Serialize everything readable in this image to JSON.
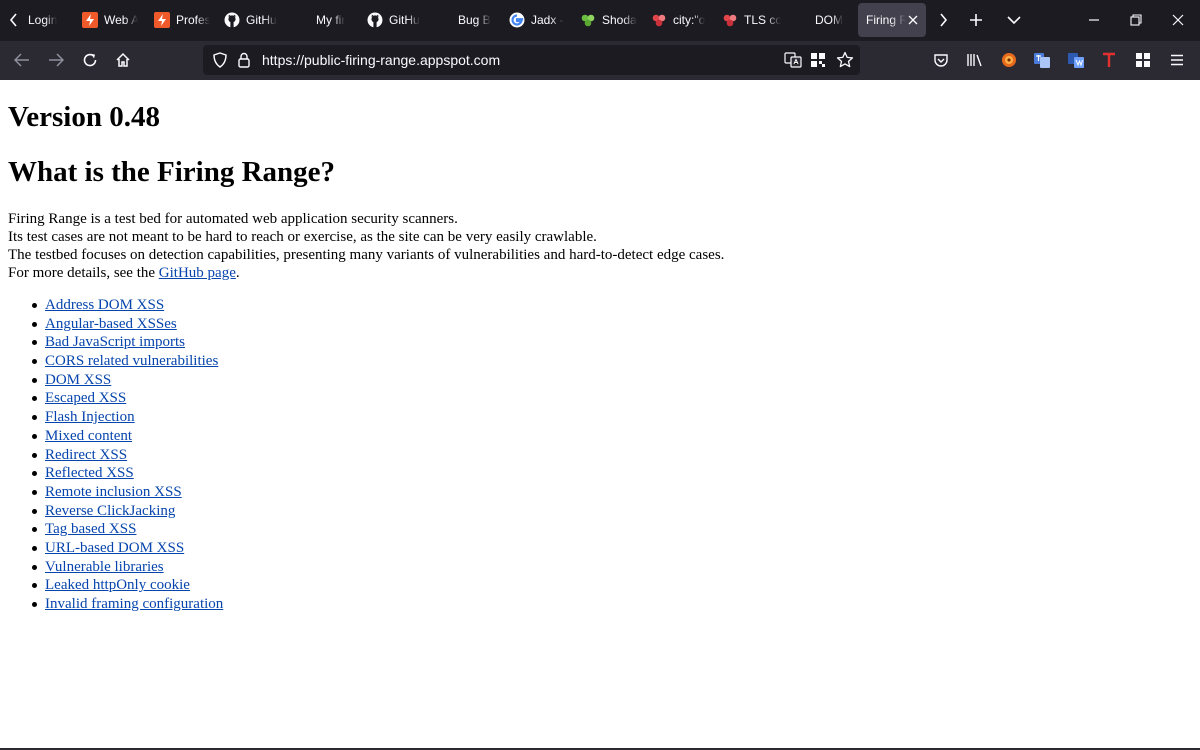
{
  "browser": {
    "tabs": [
      {
        "label": "Login",
        "icon": "login-icon"
      },
      {
        "label": "Web A",
        "icon": "bolt-icon"
      },
      {
        "label": "Profes",
        "icon": "bolt-icon"
      },
      {
        "label": "GitHu",
        "icon": "github-icon"
      },
      {
        "label": "My fir",
        "icon": ""
      },
      {
        "label": "GitHu",
        "icon": "github-icon"
      },
      {
        "label": "Bug B",
        "icon": ""
      },
      {
        "label": "Jadx -",
        "icon": "google-icon"
      },
      {
        "label": "Shoda",
        "icon": "shodan-icon"
      },
      {
        "label": "city:\"o",
        "icon": "shodan-red-icon"
      },
      {
        "label": "TLS cc",
        "icon": "shodan-red-icon"
      },
      {
        "label": "DOM",
        "icon": ""
      },
      {
        "label": "Firing R",
        "icon": "",
        "active": true
      }
    ],
    "url": "https://public-firing-range.appspot.com",
    "colors": {
      "tabbar": "#1c1b22",
      "navbar": "#2b2a33",
      "urlbar": "#1c1b22",
      "link": "#0645ad"
    }
  },
  "page": {
    "version_heading": "Version 0.48",
    "main_heading": "What is the Firing Range?",
    "intro_lines": [
      "Firing Range is a test bed for automated web application security scanners.",
      "Its test cases are not meant to be hard to reach or exercise, as the site can be very easily crawlable.",
      "The testbed focuses on detection capabilities, presenting many variants of vulnerabilities and hard-to-detect edge cases."
    ],
    "details_prefix": "For more details, see the ",
    "details_link": "GitHub page",
    "details_suffix": ".",
    "links": [
      "Address DOM XSS",
      "Angular-based XSSes",
      "Bad JavaScript imports",
      "CORS related vulnerabilities",
      "DOM XSS",
      "Escaped XSS",
      "Flash Injection",
      "Mixed content",
      "Redirect XSS",
      "Reflected XSS",
      "Remote inclusion XSS",
      "Reverse ClickJacking",
      "Tag based XSS",
      "URL-based DOM XSS",
      "Vulnerable libraries",
      "Leaked httpOnly cookie",
      "Invalid framing configuration"
    ]
  }
}
